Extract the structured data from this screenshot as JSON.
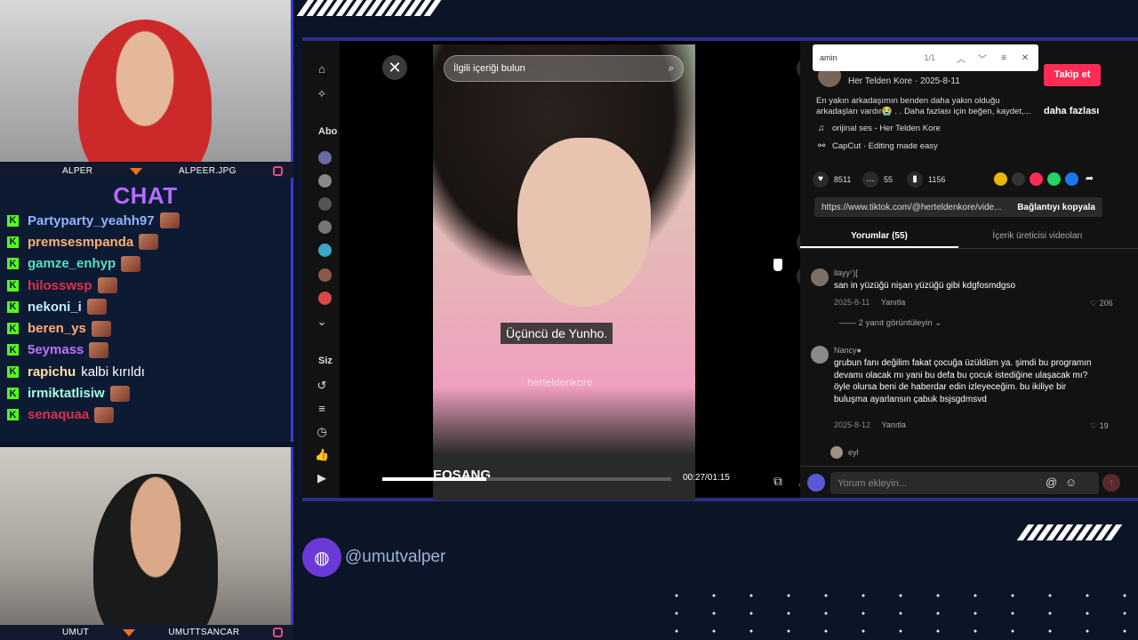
{
  "overlay": {
    "cam_top": {
      "left_name": "ALPER",
      "right_name": "ALPEER.JPG"
    },
    "cam_bottom": {
      "left_name": "UMUT",
      "right_name": "UMUTTSANCAR"
    },
    "chat_title": "CHAT",
    "chat": [
      {
        "user": "Partyparty_yeahh97",
        "color": "#8fb4ff",
        "msg": ""
      },
      {
        "user": "premsesmpanda",
        "color": "#ffb070",
        "msg": ""
      },
      {
        "user": "gamze_enhyp",
        "color": "#56e0c0",
        "msg": ""
      },
      {
        "user": "hilosswsp",
        "color": "#e0304a",
        "msg": ""
      },
      {
        "user": "nekoni_i",
        "color": "#c0f0ff",
        "msg": ""
      },
      {
        "user": "beren_ys",
        "color": "#ffb070",
        "msg": ""
      },
      {
        "user": "5eymass",
        "color": "#c070ff",
        "msg": ""
      },
      {
        "user": "rapichu",
        "color": "#ffe0a0",
        "msg": "kalbi kırıldı"
      },
      {
        "user": "irmiktatlisiw",
        "color": "#a0ffe0",
        "msg": ""
      },
      {
        "user": "senaquaa",
        "color": "#e0304a",
        "msg": ""
      }
    ],
    "handle": "@umutvalper"
  },
  "sidebar": {
    "section_abo": "Abo",
    "section_siz": "Siz"
  },
  "viewer": {
    "search_placeholder": "İlgili içeriği bulun",
    "subtitle": "Üçüncü de Yunho.",
    "watermark": "herteldenkore",
    "brand_wm": "EOSANG",
    "time": "00:27/01:15",
    "progress": 0.36
  },
  "find_bar": {
    "query": "amin",
    "count": "1/1"
  },
  "post": {
    "author_line": "Her Telden Kore · 2025-8-11",
    "follow": "Takip et",
    "description": "En yakın arkadaşımın benden daha yakın olduğu arkadaşları vardır😭 . . Daha fazlası için beğen, kaydet,...",
    "more": "daha fazlası",
    "sound": "orijinal ses - Her Telden Kore",
    "capcut": "CapCut · Editing made easy",
    "likes": "8511",
    "comments": "55",
    "saves": "1156",
    "url": "https://www.tiktok.com/@herteldenkore/vide...",
    "copy_link": "Bağlantıyı kopyala"
  },
  "tabs": {
    "comments": "Yorumlar (55)",
    "creator": "İçerik üreticisi videoları"
  },
  "comments": [
    {
      "user": "ilayy⁷)[",
      "text": "san in yüzüğü nişan yüzüğü gibi kdgfosmdgso",
      "date": "2025-8-11",
      "reply": "Yanıtla",
      "likes": "206",
      "replies_toggle": "2 yanıt görüntüleyin"
    },
    {
      "user": "Nancy●",
      "text": "grubun fanı değilim fakat çocuğa üzüldüm ya. şimdi bu programın devamı olacak mı yani bu defa bu çocuk istediğine ulaşacak mı? öyle olursa beni de haberdar edin izleyeceğim. bu ikiliye bir buluşma ayarlansın çabuk bsjsgdmsvd",
      "date": "2025-8-12",
      "reply": "Yanıtla",
      "likes": "19"
    },
    {
      "user": "eyl"
    }
  ],
  "comment_input": {
    "placeholder": "Yorum ekleyin..."
  }
}
